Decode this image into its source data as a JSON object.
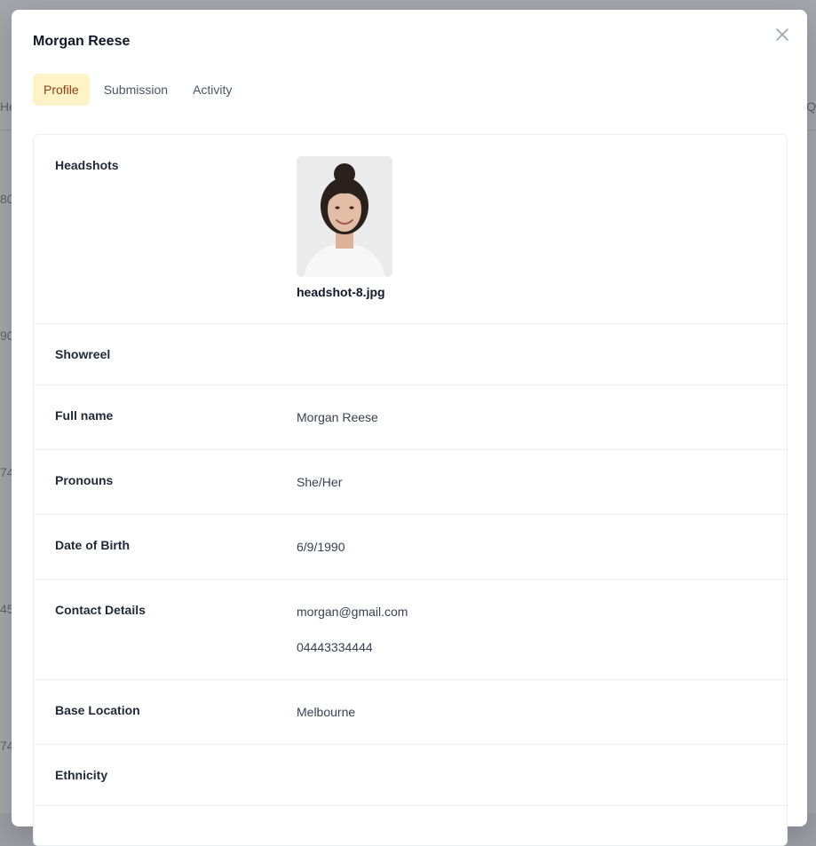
{
  "modal": {
    "title": "Morgan Reese",
    "close_icon": "close-icon"
  },
  "tabs": [
    {
      "label": "Profile",
      "active": true
    },
    {
      "label": "Submission",
      "active": false
    },
    {
      "label": "Activity",
      "active": false
    }
  ],
  "profile": {
    "headshots": {
      "label": "Headshots",
      "files": [
        {
          "name": "headshot-8.jpg"
        }
      ]
    },
    "showreel": {
      "label": "Showreel",
      "value": ""
    },
    "full_name": {
      "label": "Full name",
      "value": "Morgan Reese"
    },
    "pronouns": {
      "label": "Pronouns",
      "value": "She/Her"
    },
    "dob": {
      "label": "Date of Birth",
      "value": "6/9/1990"
    },
    "contact": {
      "label": "Contact Details",
      "email": "morgan@gmail.com",
      "phone": "04443334444"
    },
    "location": {
      "label": "Base Location",
      "value": "Melbourne"
    },
    "ethnicity": {
      "label": "Ethnicity",
      "value": ""
    }
  },
  "background": {
    "fragments": [
      "He",
      "80",
      "90",
      "74",
      "45",
      "74",
      "Q"
    ]
  }
}
